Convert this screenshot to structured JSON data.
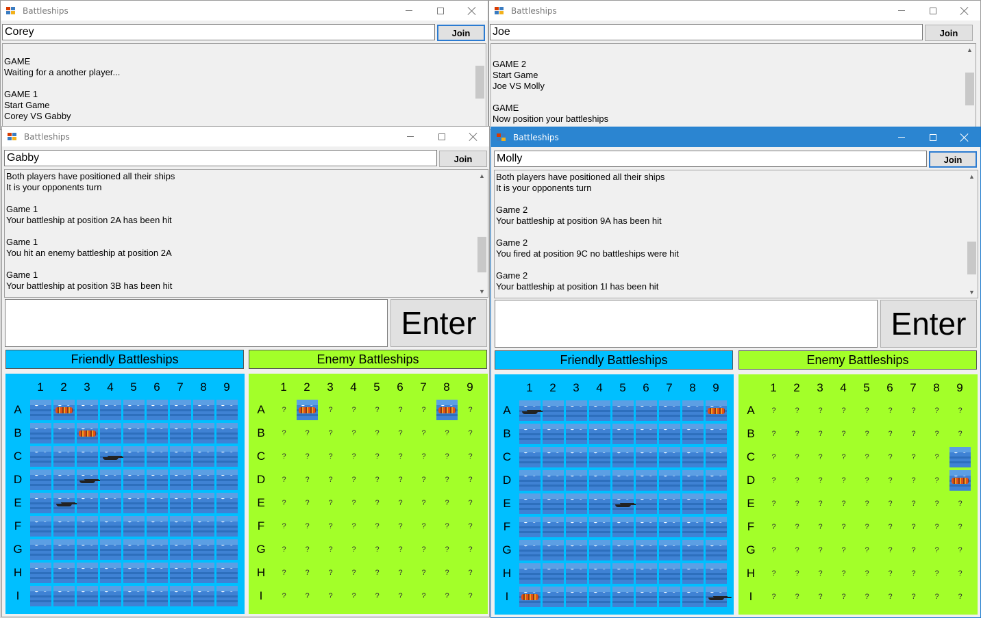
{
  "windows": {
    "corey": {
      "title": "Battleships",
      "name": "Corey",
      "join": "Join",
      "log": [
        "",
        "GAME",
        "Waiting for a another player...",
        "",
        "GAME 1",
        "Start Game",
        "Corey VS Gabby"
      ]
    },
    "joe": {
      "title": "Battleships",
      "name": "Joe",
      "join": "Join",
      "log": [
        "",
        "GAME 2",
        "Start Game",
        "Joe VS Molly",
        "",
        "GAME",
        "Now position your battleships"
      ]
    },
    "gabby": {
      "title": "Battleships",
      "name": "Gabby",
      "join": "Join",
      "enter": "Enter",
      "friendly_header": "Friendly Battleships",
      "enemy_header": "Enemy Battleships",
      "log": [
        "Both players have positioned all their ships",
        "It is your opponents turn",
        "",
        "Game 1",
        "Your battleship at position 2A has been hit",
        "",
        "Game 1",
        "You hit an enemy battleship at position 2A",
        "",
        "Game 1",
        "Your battleship at position 3B has been hit"
      ],
      "friendly_cells": {
        "A2": "hit",
        "B3": "hit",
        "C4": "ship",
        "D3": "ship",
        "E2": "ship"
      },
      "enemy_cells": {
        "A2": "hit",
        "A8": "hit"
      }
    },
    "molly": {
      "title": "Battleships",
      "name": "Molly",
      "join": "Join",
      "enter": "Enter",
      "friendly_header": "Friendly Battleships",
      "enemy_header": "Enemy Battleships",
      "log": [
        "Both players have positioned all their ships",
        "It is your opponents turn",
        "",
        "Game 2",
        "Your battleship at position 9A has been hit",
        "",
        "Game 2",
        "You fired at position 9C no battleships were hit",
        "",
        "Game 2",
        "Your battleship at position 1I has been hit"
      ],
      "friendly_cells": {
        "A1": "ship",
        "A9": "hit",
        "E5": "ship",
        "I1": "hit",
        "I9": "ship"
      },
      "enemy_cells": {
        "C9": "water",
        "D9": "hit"
      }
    }
  },
  "grid": {
    "columns": [
      "1",
      "2",
      "3",
      "4",
      "5",
      "6",
      "7",
      "8",
      "9"
    ],
    "rows": [
      "A",
      "B",
      "C",
      "D",
      "E",
      "F",
      "G",
      "H",
      "I"
    ],
    "unknown_mark": "?"
  },
  "colors": {
    "friendly": "#00bfff",
    "enemy": "#a3ff29",
    "active_titlebar": "#2b85d1"
  },
  "icons": {
    "window": "battleships-app-icon",
    "minimize": "minimize-icon",
    "maximize": "maximize-icon",
    "close": "close-icon"
  }
}
